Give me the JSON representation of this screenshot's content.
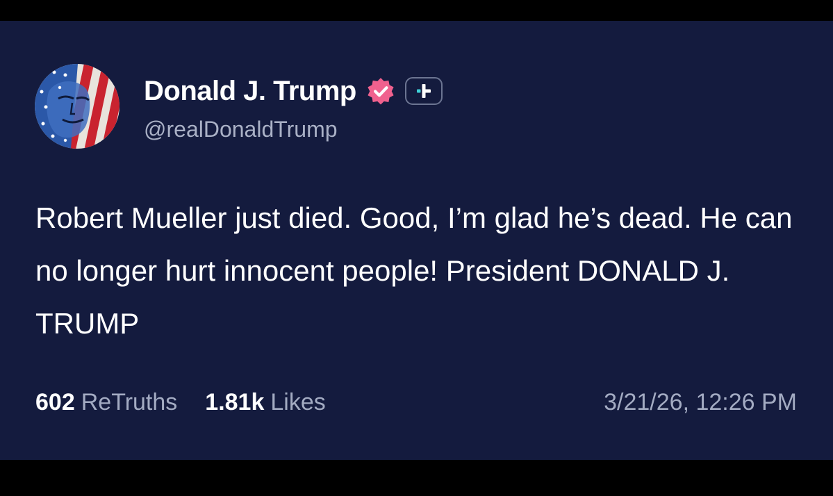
{
  "post": {
    "display_name": "Donald J. Trump",
    "handle": "@realDonaldTrump",
    "text": "Robert Mueller just died. Good, I’m glad he’s dead. He can no longer hurt innocent people! President DONALD J. TRUMP",
    "retruths_count": "602",
    "retruths_label": "ReTruths",
    "likes_count": "1.81k",
    "likes_label": "Likes",
    "timestamp": "3/21/26, 12:26 PM"
  },
  "icons": {
    "verified": "verified-badge-icon",
    "plus": "plus-badge-icon",
    "avatar": "flag-portrait-avatar"
  },
  "colors": {
    "background": "#141b3e",
    "text": "#ffffff",
    "muted_text": "#a3abc2",
    "verified_badge": "#f0618e",
    "plus_accent": "#3fd1d8"
  }
}
